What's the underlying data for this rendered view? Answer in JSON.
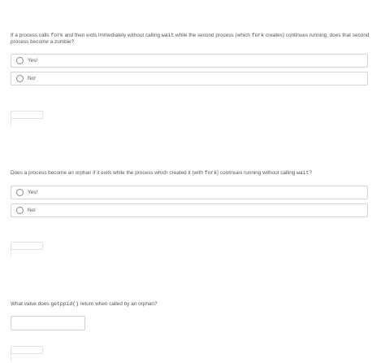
{
  "q1": {
    "parts": [
      "If a process calls ",
      "fork",
      " and then exits immediately without calling ",
      "wait",
      " while the second process (which ",
      "fork",
      " creates) continues running, does that second process become a zombie?"
    ],
    "options": [
      "Yes!",
      "No!"
    ]
  },
  "q2": {
    "parts": [
      "Does a process become an orphan if it exits while the process which created it (with ",
      "fork",
      ") continues running without calling ",
      "wait",
      "?"
    ],
    "options": [
      "Yes!",
      "No!"
    ]
  },
  "q3": {
    "parts": [
      "What value does ",
      "getppid()",
      " return when called by an orphan?"
    ],
    "answer_value": ""
  }
}
